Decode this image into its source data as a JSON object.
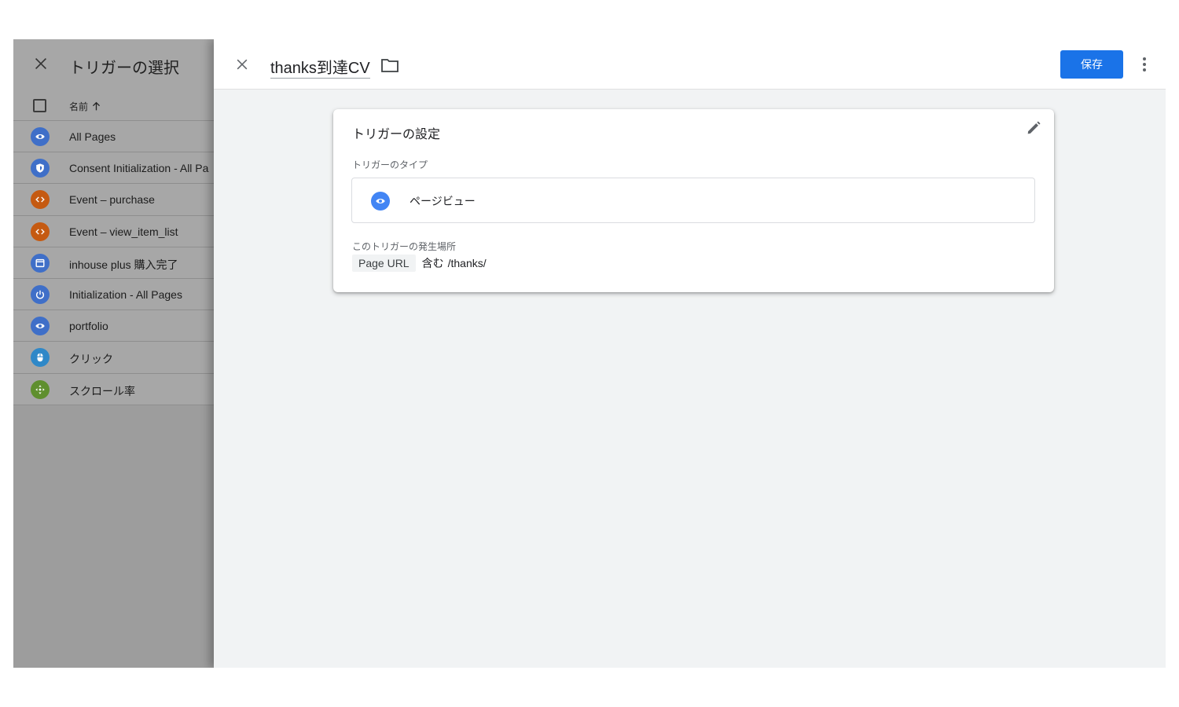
{
  "left_panel": {
    "title": "トリガーの選択",
    "column_header": "名前",
    "items": [
      {
        "label": "All Pages",
        "icon": "eye-icon",
        "color": "#3f6fc8"
      },
      {
        "label": "Consent Initialization - All Pa",
        "icon": "shield-icon",
        "color": "#3f6fc8"
      },
      {
        "label": "Event – purchase",
        "icon": "code-icon",
        "color": "#c55a11"
      },
      {
        "label": "Event – view_item_list",
        "icon": "code-icon",
        "color": "#c55a11"
      },
      {
        "label": "inhouse plus 購入完了",
        "icon": "window-icon",
        "color": "#3f6fc8"
      },
      {
        "label": "Initialization - All Pages",
        "icon": "power-icon",
        "color": "#3f6fc8"
      },
      {
        "label": "portfolio",
        "icon": "eye-icon",
        "color": "#3f6fc8"
      },
      {
        "label": "クリック",
        "icon": "mouse-icon",
        "color": "#2f88c8"
      },
      {
        "label": "スクロール率",
        "icon": "move-icon",
        "color": "#5f8f2e"
      }
    ]
  },
  "editor": {
    "name": "thanks到達CV",
    "save_label": "保存",
    "card": {
      "title": "トリガーの設定",
      "type_label": "トリガーのタイプ",
      "type_name": "ページビュー",
      "fires_label": "このトリガーの発生場所",
      "condition": {
        "variable": "Page URL",
        "operator": "含む",
        "value": "/thanks/"
      }
    }
  },
  "colors": {
    "accent": "#1a73e8",
    "pageview_icon": "#4285f4",
    "panel_bg": "#f1f3f4"
  }
}
